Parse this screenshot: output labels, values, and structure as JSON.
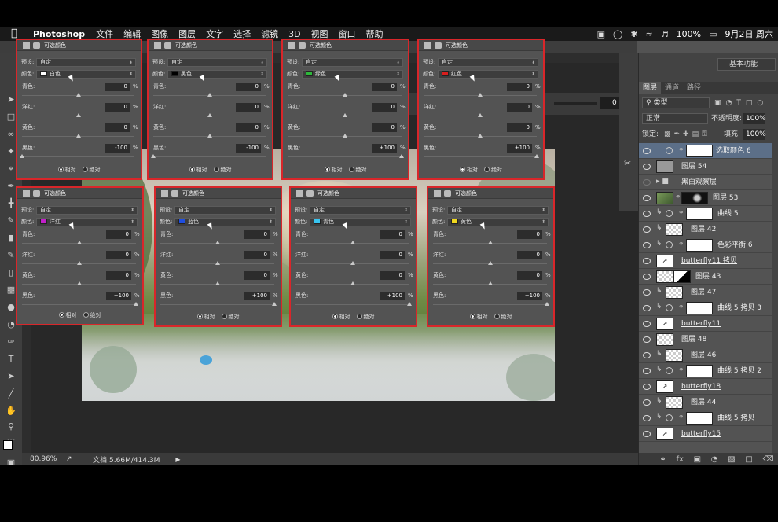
{
  "menubar": {
    "app_name": "Photoshop",
    "menus": [
      "文件",
      "编辑",
      "图像",
      "图层",
      "文字",
      "选择",
      "滤镜",
      "3D",
      "视图",
      "窗口",
      "帮助"
    ],
    "battery": "100%",
    "clock": "9月2日 周六"
  },
  "options_bar": {
    "value": "0",
    "unit": "%"
  },
  "status_bar": {
    "zoom": "80.96%",
    "doc_info": "文档:5.66M/414.3M"
  },
  "right_panel": {
    "workspace": "基本功能",
    "tabs": [
      "图层",
      "通道",
      "路径"
    ],
    "filter_kind": "类型",
    "blend_mode": "正常",
    "opacity_label": "不透明度:",
    "opacity": "100%",
    "lock_label": "锁定:",
    "fill_label": "填充:",
    "fill": "100%",
    "layers": [
      {
        "name": "选取颜色 6",
        "selected": true,
        "visible": true,
        "kind": "adjust"
      },
      {
        "name": "图层 54",
        "visible": true,
        "kind": "grey"
      },
      {
        "name": "黑白观察层",
        "visible": false,
        "kind": "folder"
      },
      {
        "name": "图层 53",
        "visible": true,
        "kind": "photo-mask"
      },
      {
        "name": "曲线 5",
        "visible": true,
        "kind": "adjust-clip"
      },
      {
        "name": "图层 42",
        "visible": true,
        "kind": "check-clip"
      },
      {
        "name": "色彩平衡 6",
        "visible": true,
        "kind": "adjust-clip"
      },
      {
        "name": "butterfly11 拷贝",
        "visible": true,
        "kind": "smart"
      },
      {
        "name": "图层 43",
        "visible": true,
        "kind": "check-half"
      },
      {
        "name": "图层 47",
        "visible": true,
        "kind": "check-clip"
      },
      {
        "name": "曲线 5 拷贝 3",
        "visible": true,
        "kind": "adjust-clip"
      },
      {
        "name": "butterfly11",
        "visible": true,
        "kind": "smart"
      },
      {
        "name": "图层 48",
        "visible": true,
        "kind": "check"
      },
      {
        "name": "图层 46",
        "visible": true,
        "kind": "check-clip"
      },
      {
        "name": "曲线 5 拷贝 2",
        "visible": true,
        "kind": "adjust-clip"
      },
      {
        "name": "butterfly18",
        "visible": true,
        "kind": "smart"
      },
      {
        "name": "图层 44",
        "visible": true,
        "kind": "check-clip"
      },
      {
        "name": "曲线 5 拷贝",
        "visible": true,
        "kind": "adjust-clip"
      },
      {
        "name": "butterfly15",
        "visible": true,
        "kind": "smart"
      }
    ]
  },
  "dialog_labels": {
    "title": "可选颜色",
    "preset_label": "预设:",
    "preset_value": "自定",
    "color_label": "颜色:",
    "cyan": "青色:",
    "magenta": "洋红:",
    "yellow": "黄色:",
    "black": "黑色:",
    "percent": "%",
    "relative": "相对",
    "absolute": "绝对"
  },
  "dialogs": [
    {
      "color_name": "白色",
      "swatch": "#ffffff",
      "cyan": "0",
      "magenta": "0",
      "yellow": "0",
      "black": "-100",
      "black_level": 0.0
    },
    {
      "color_name": "黑色",
      "swatch": "#000000",
      "cyan": "0",
      "magenta": "0",
      "yellow": "0",
      "black": "-100",
      "black_level": 0.0
    },
    {
      "color_name": "绿色",
      "swatch": "#2db83a",
      "cyan": "0",
      "magenta": "0",
      "yellow": "0",
      "black": "+100",
      "black_level": 1.0
    },
    {
      "color_name": "红色",
      "swatch": "#d81e1e",
      "cyan": "0",
      "magenta": "0",
      "yellow": "0",
      "black": "+100",
      "black_level": 1.0
    },
    {
      "color_name": "洋红",
      "swatch": "#c21fc9",
      "cyan": "0",
      "magenta": "0",
      "yellow": "0",
      "black": "+100",
      "black_level": 1.0
    },
    {
      "color_name": "蓝色",
      "swatch": "#1f4ee0",
      "cyan": "0",
      "magenta": "0",
      "yellow": "0",
      "black": "+100",
      "black_level": 1.0
    },
    {
      "color_name": "青色",
      "swatch": "#38c4f0",
      "cyan": "0",
      "magenta": "0",
      "yellow": "0",
      "black": "+100",
      "black_level": 1.0
    },
    {
      "color_name": "黄色",
      "swatch": "#f0d81e",
      "cyan": "0",
      "magenta": "0",
      "yellow": "0",
      "black": "+100",
      "black_level": 1.0
    }
  ],
  "colors": {
    "highlight_border": "#d9262a",
    "selected_layer": "#5c6f88"
  }
}
